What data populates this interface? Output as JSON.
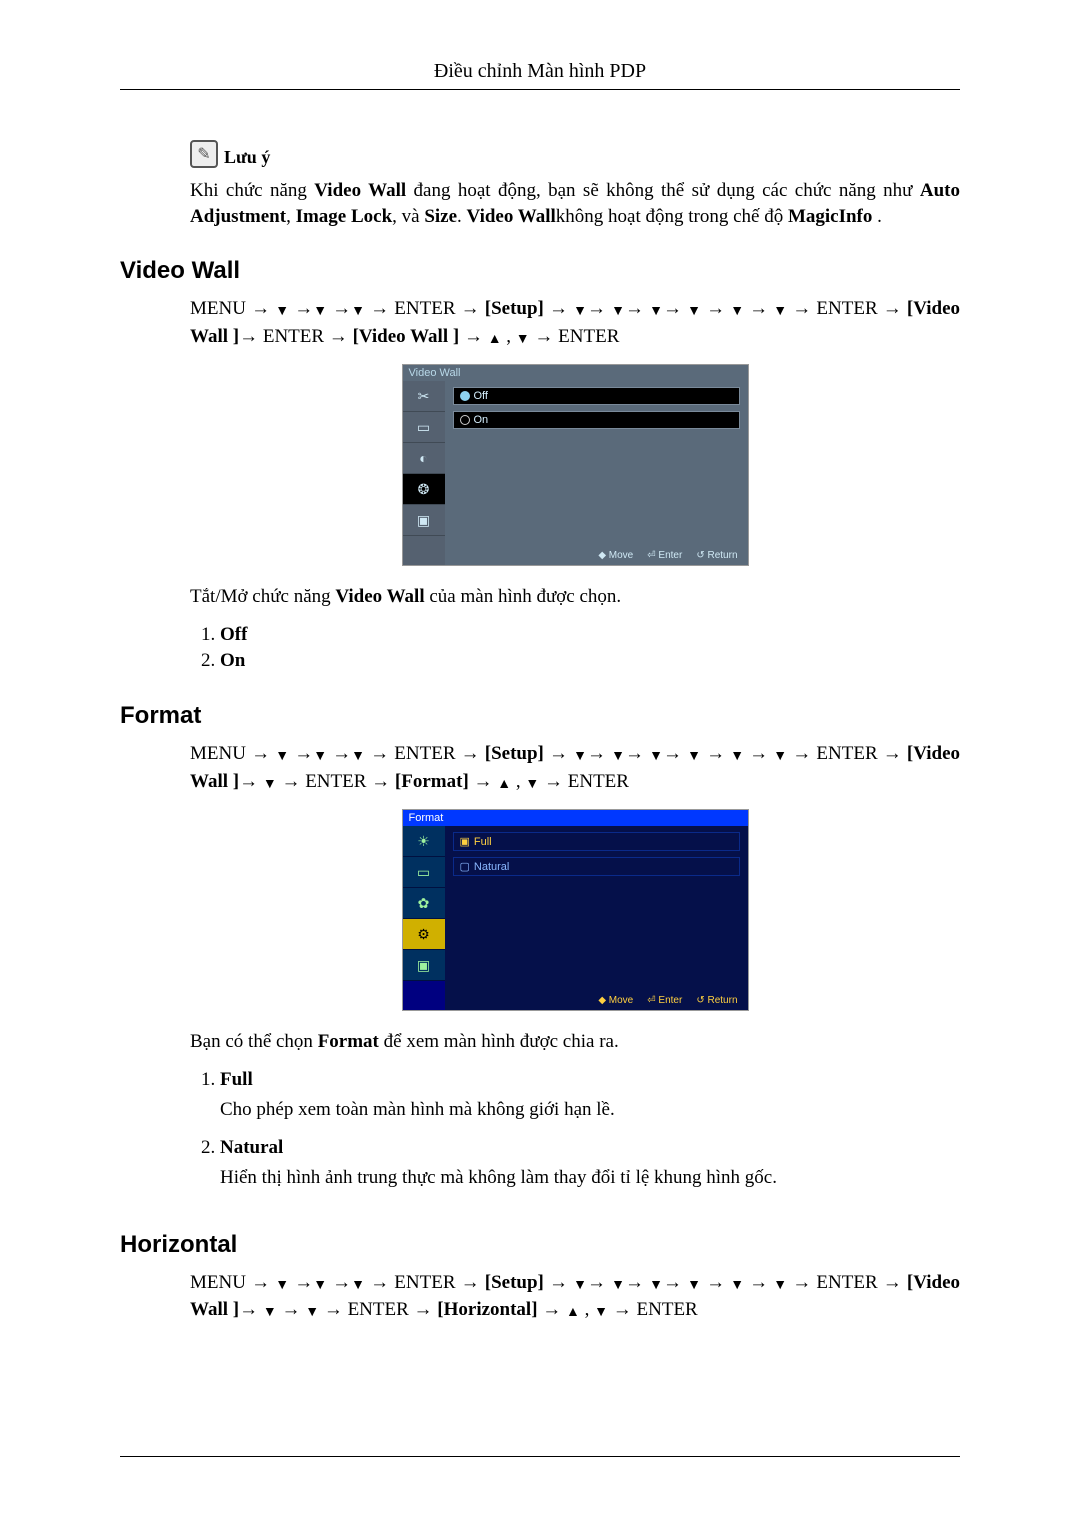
{
  "header": {
    "title": "Điều chỉnh Màn hình PDP"
  },
  "note": {
    "icon_glyph": "✎",
    "label": "Lưu ý",
    "text_1": "Khi chức năng ",
    "bold_1": "Video Wall",
    "text_2": " đang hoạt động, bạn sẽ không thể sử dụng các chức năng như ",
    "bold_2": "Auto Adjustment",
    "sep_1": ", ",
    "bold_3": "Image Lock",
    "sep_2": ", và ",
    "bold_4": "Size",
    "sep_3": ". ",
    "bold_5": "Video Wall",
    "text_3": "không hoạt động trong chế độ ",
    "bold_6": "MagicInfo",
    "text_4": " ."
  },
  "sections": {
    "video_wall": {
      "title": "Video Wall",
      "path_parts": {
        "p1": "MENU → ",
        "arr": "▼",
        "p2": " →",
        "p3": " →",
        "p4": " → ENTER → ",
        "setup": "[Setup]",
        "p5": " → ",
        "p6": "→ ",
        "p7": "→ ",
        "p8": "→ ",
        "p9": " → ",
        "p10": " → ",
        "p11": " → ENTER → ",
        "vw1": "[Video Wall ]",
        "p12": "→ ENTER → ",
        "vw2": "[Video Wall ]",
        "p13": " → ",
        "up": "▲",
        "comma": " , ",
        "p14": " → ENTER"
      },
      "desc_1": "Tắt/Mở chức năng ",
      "desc_bold": "Video Wall",
      "desc_2": " của màn hình được chọn.",
      "options": [
        {
          "label": "Off"
        },
        {
          "label": "On"
        }
      ],
      "osd": {
        "title": "Video Wall",
        "options": [
          {
            "label": "Off",
            "selected": true
          },
          {
            "label": "On",
            "selected": false
          }
        ],
        "footer": {
          "move": "Move",
          "enter": "Enter",
          "ret": "Return"
        }
      }
    },
    "format": {
      "title": "Format",
      "path_parts": {
        "p1": "MENU → ",
        "arr": "▼",
        "p2": " →",
        "p3": " →",
        "p4": " → ENTER → ",
        "setup": "[Setup]",
        "p5": " → ",
        "p6": "→ ",
        "p7": "→ ",
        "p8": "→ ",
        "p9": " → ",
        "p10": " → ",
        "p11": " → ENTER → ",
        "vw1": "[Video Wall ]",
        "p12a": "→ ",
        "p12b": " → ENTER → ",
        "fmt": "[Format]",
        "p13": " → ",
        "up": "▲",
        "comma": " , ",
        "p14": " → ENTER"
      },
      "desc_1": "Bạn có thể chọn ",
      "desc_bold": "Format",
      "desc_2": " để xem màn hình được chia ra.",
      "options": [
        {
          "label": "Full",
          "desc": "Cho phép xem toàn màn hình mà không giới hạn lề."
        },
        {
          "label": "Natural",
          "desc": "Hiển thị hình ảnh trung thực mà không làm thay đổi tỉ lệ khung hình gốc."
        }
      ],
      "osd": {
        "title": "Format",
        "options": [
          {
            "label": "Full",
            "selected": true
          },
          {
            "label": "Natural",
            "selected": false
          }
        ],
        "footer": {
          "move": "Move",
          "enter": "Enter",
          "ret": "Return"
        }
      }
    },
    "horizontal": {
      "title": "Horizontal",
      "path_parts": {
        "p1": "MENU → ",
        "arr": "▼",
        "p2": " →",
        "p3": " →",
        "p4": " → ENTER → ",
        "setup": "[Setup]",
        "p5": " → ",
        "p6": "→ ",
        "p7": "→ ",
        "p8": "→ ",
        "p9": " → ",
        "p10": " → ",
        "p11": " → ENTER → ",
        "vw1": "[Video Wall ]",
        "p12a": "→ ",
        "p12b": " → ",
        "p12c": " → ENTER → ",
        "hor": "[Horizontal]",
        "p13": " → ",
        "up": "▲",
        "comma": " , ",
        "p14": " → ENTER"
      }
    }
  }
}
